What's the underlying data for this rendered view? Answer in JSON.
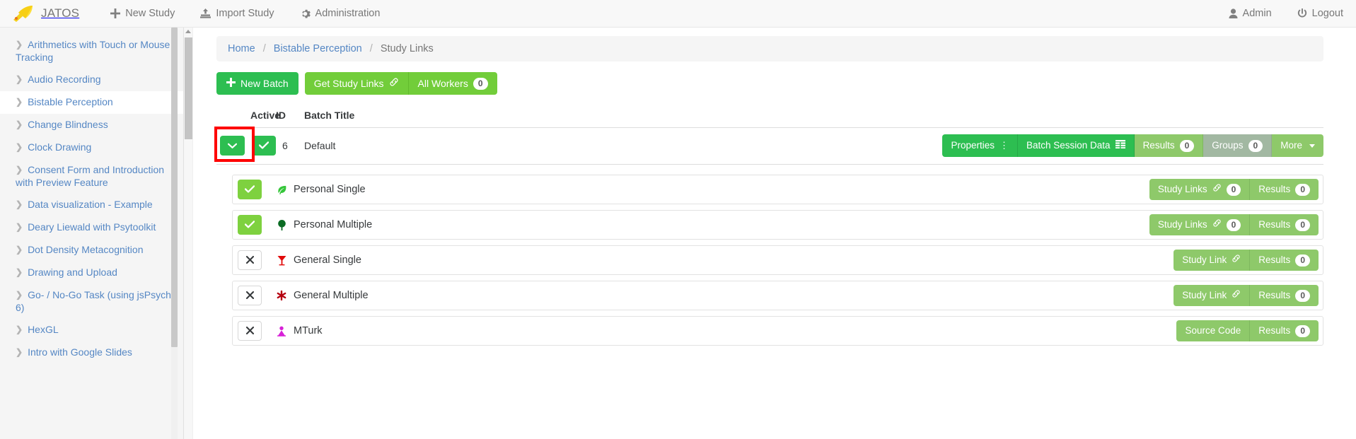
{
  "navbar": {
    "brand": "JATOS",
    "logo_icon": "rocket-icon",
    "links": [
      {
        "label": "New Study",
        "icon": "plus-icon"
      },
      {
        "label": "Import Study",
        "icon": "import-icon"
      },
      {
        "label": "Administration",
        "icon": "gear-icon"
      }
    ],
    "right_links": [
      {
        "label": "Admin",
        "icon": "user-icon"
      },
      {
        "label": "Logout",
        "icon": "power-icon"
      }
    ]
  },
  "sidebar": {
    "items": [
      {
        "label": "Arithmetics with Touch or Mouse Tracking",
        "active": false
      },
      {
        "label": "Audio Recording",
        "active": false
      },
      {
        "label": "Bistable Perception",
        "active": true
      },
      {
        "label": "Change Blindness",
        "active": false
      },
      {
        "label": "Clock Drawing",
        "active": false
      },
      {
        "label": "Consent Form and Introduction with Preview Feature",
        "active": false
      },
      {
        "label": "Data visualization - Example",
        "active": false
      },
      {
        "label": "Deary Liewald with Psytoolkit",
        "active": false
      },
      {
        "label": "Dot Density Metacognition",
        "active": false
      },
      {
        "label": "Drawing and Upload",
        "active": false
      },
      {
        "label": "Go- / No-Go Task (using jsPsych 6)",
        "active": false
      },
      {
        "label": "HexGL",
        "active": false
      },
      {
        "label": "Intro with Google Slides",
        "active": false
      }
    ]
  },
  "breadcrumb": {
    "home": "Home",
    "study": "Bistable Perception",
    "current": "Study Links"
  },
  "toolbar": {
    "new_batch": "New Batch",
    "get_study_links": "Get Study Links",
    "all_workers": "All Workers",
    "all_workers_count": "0"
  },
  "table": {
    "headers": {
      "active": "Active",
      "id": "ID",
      "title": "Batch Title"
    }
  },
  "batch": {
    "id": "6",
    "title": "Default",
    "expand_icon": "chevron-down-icon",
    "active_icon": "check-icon",
    "actions": {
      "properties": "Properties",
      "batch_session_data": "Batch Session Data",
      "results": "Results",
      "results_count": "0",
      "groups": "Groups",
      "groups_count": "0",
      "more": "More"
    }
  },
  "workers": [
    {
      "name": "Personal Single",
      "icon": "leaf-icon",
      "icon_color": "#35c63a",
      "enabled": true,
      "toggle_icon": "check-icon",
      "action_label": "Study Links",
      "action_count": "0",
      "action_style": "light",
      "results_label": "Results",
      "results_count": "0"
    },
    {
      "name": "Personal Multiple",
      "icon": "tree-icon",
      "icon_color": "#0a6b23",
      "enabled": true,
      "toggle_icon": "check-icon",
      "action_label": "Study Links",
      "action_count": "0",
      "action_style": "light",
      "results_label": "Results",
      "results_count": "0"
    },
    {
      "name": "General Single",
      "icon": "martini-icon",
      "icon_color": "#e10a0a",
      "enabled": false,
      "toggle_icon": "cross-icon",
      "action_label": "Study Link",
      "action_count": "",
      "action_style": "mid",
      "results_label": "Results",
      "results_count": "0"
    },
    {
      "name": "General Multiple",
      "icon": "asterisk-icon",
      "icon_color": "#b5000f",
      "enabled": false,
      "toggle_icon": "cross-icon",
      "action_label": "Study Link",
      "action_count": "",
      "action_style": "mid",
      "results_label": "Results",
      "results_count": "0"
    },
    {
      "name": "MTurk",
      "icon": "mturk-icon",
      "icon_color": "#d721d7",
      "enabled": false,
      "toggle_icon": "cross-icon",
      "action_label": "Source Code",
      "action_count": "",
      "action_style": "mid",
      "results_label": "Results",
      "results_count": "0"
    }
  ]
}
